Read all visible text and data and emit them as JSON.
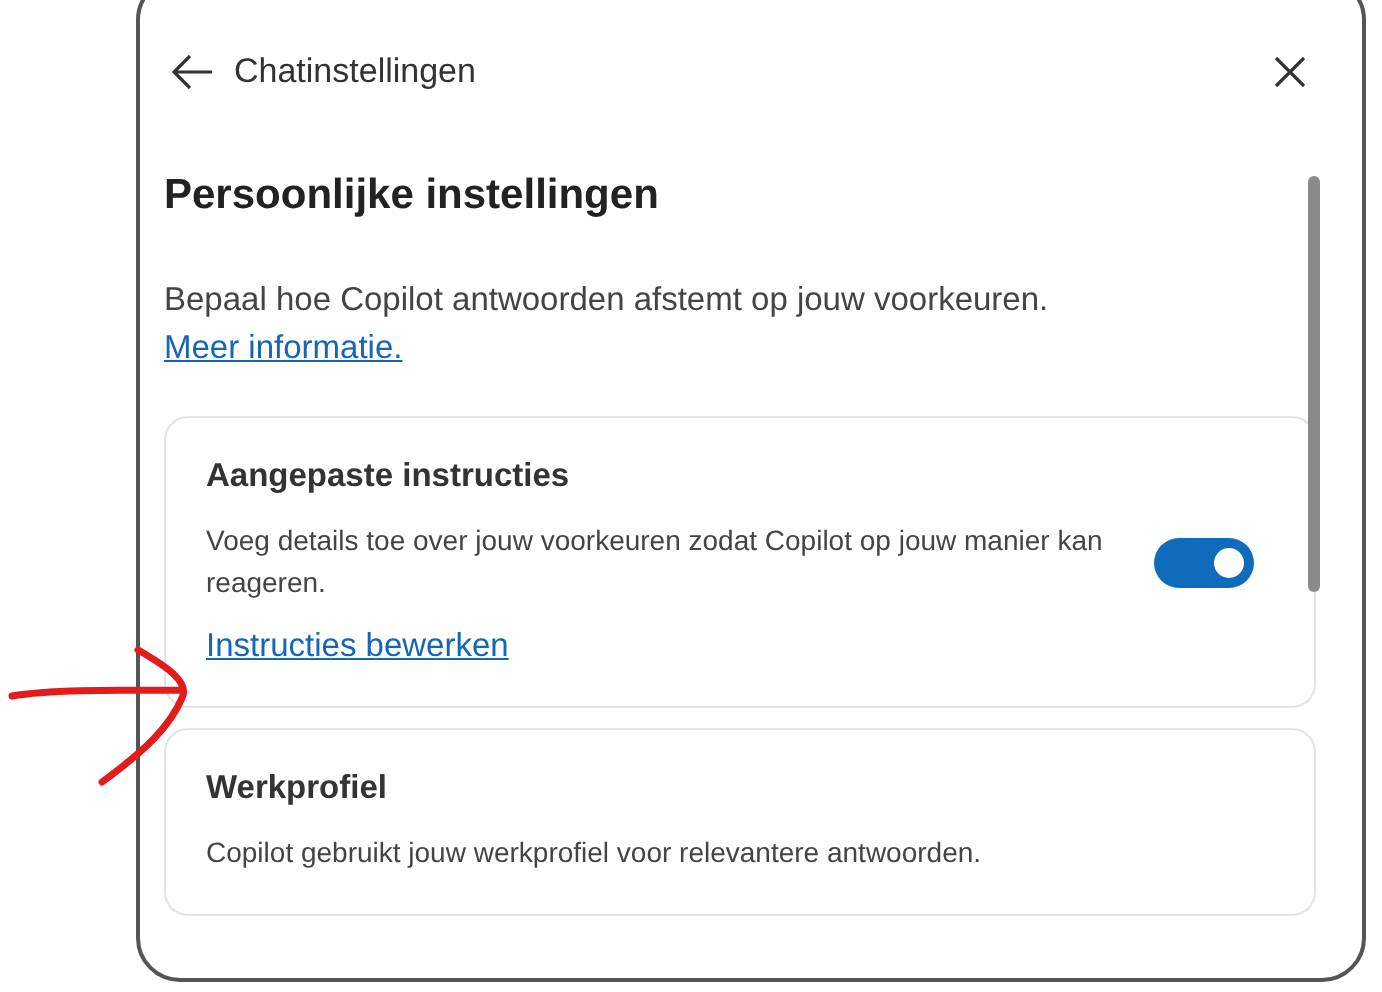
{
  "header": {
    "title": "Chatinstellingen"
  },
  "section": {
    "title": "Persoonlijke instellingen",
    "description": "Bepaal hoe Copilot antwoorden afstemt op jouw voorkeuren.",
    "link": "Meer informatie."
  },
  "cards": [
    {
      "title": "Aangepaste instructies",
      "description": "Voeg details toe over jouw voorkeuren zodat Copilot op jouw manier kan reageren.",
      "on": true,
      "link": "Instructies bewerken"
    },
    {
      "title": "Werkprofiel",
      "description": "Copilot gebruikt jouw werkprofiel voor relevantere antwoorden."
    }
  ]
}
